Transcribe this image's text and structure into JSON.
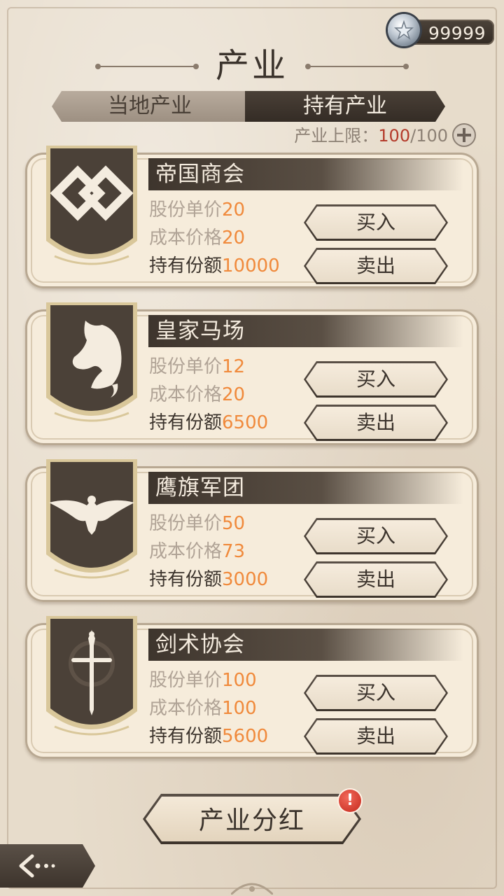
{
  "currency": {
    "value": "99999",
    "icon": "silver-coin-icon"
  },
  "title": "产业",
  "tabs": {
    "local": "当地产业",
    "owned": "持有产业",
    "active": "owned"
  },
  "limit": {
    "label": "产业上限：",
    "current": "100",
    "separator": "/",
    "max": "100"
  },
  "labels": {
    "unit_price": "股份单价",
    "cost_price": "成本价格",
    "held_shares": "持有份额",
    "buy": "买入",
    "sell": "卖出"
  },
  "industries": [
    {
      "name": "帝国商会",
      "emblem": "chain-knot-icon",
      "unit_price": "20",
      "cost_price": "20",
      "held_shares": "10000"
    },
    {
      "name": "皇家马场",
      "emblem": "horse-head-icon",
      "unit_price": "12",
      "cost_price": "20",
      "held_shares": "6500"
    },
    {
      "name": "鹰旗军团",
      "emblem": "eagle-icon",
      "unit_price": "50",
      "cost_price": "73",
      "held_shares": "3000"
    },
    {
      "name": "剑术协会",
      "emblem": "sword-icon",
      "unit_price": "100",
      "cost_price": "100",
      "held_shares": "5600"
    }
  ],
  "dividend": {
    "label": "产业分红",
    "badge": "!"
  },
  "colors": {
    "accent_value": "#f08a3c",
    "limit_current": "#b43a2a",
    "dark_panel": "#3e352d"
  }
}
